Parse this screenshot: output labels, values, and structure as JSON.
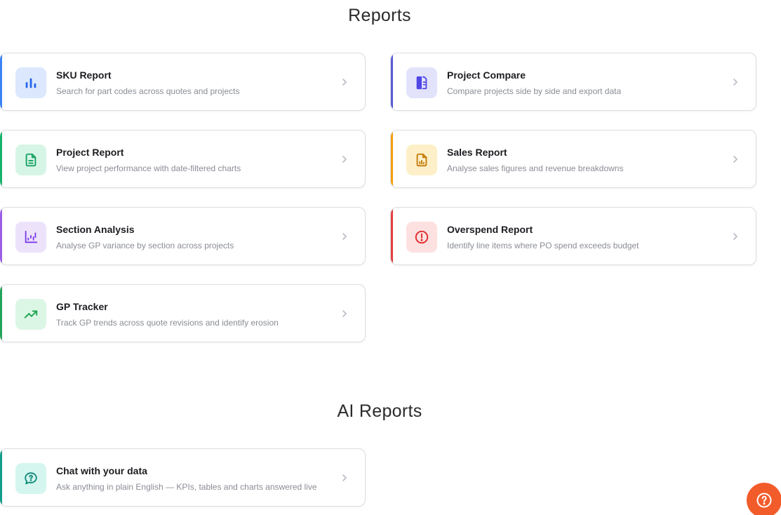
{
  "reports_heading": "Reports",
  "ai_reports_heading": "AI Reports",
  "cards": [
    {
      "title": "SKU Report",
      "description": "Search for part codes across quotes and projects",
      "accent": "#3b82f6",
      "icon_bg": "#dbe8fd",
      "icon_color": "#2563eb",
      "icon": "bar-chart-icon"
    },
    {
      "title": "Project Compare",
      "description": "Compare projects side by side and export data",
      "accent": "#5b5bd6",
      "icon_bg": "#e2e3fb",
      "icon_color": "#4f46e5",
      "icon": "compare-document-icon"
    },
    {
      "title": "Project Report",
      "description": "View project performance with date-filtered charts",
      "accent": "#16b36b",
      "icon_bg": "#d6f5e6",
      "icon_color": "#13a05f",
      "icon": "document-icon"
    },
    {
      "title": "Sales Report",
      "description": "Analyse sales figures and revenue breakdowns",
      "accent": "#f59e0b",
      "icon_bg": "#fdf0c8",
      "icon_color": "#c27803",
      "icon": "sales-document-icon"
    },
    {
      "title": "Section Analysis",
      "description": "Analyse GP variance by section across projects",
      "accent": "#9b5de5",
      "icon_bg": "#ece3fb",
      "icon_color": "#7c3aed",
      "icon": "waterfall-chart-icon"
    },
    {
      "title": "Overspend Report",
      "description": "Identify line items where PO spend exceeds budget",
      "accent": "#e53e3e",
      "icon_bg": "#fde0e0",
      "icon_color": "#dc2626",
      "icon": "alert-circle-icon"
    },
    {
      "title": "GP Tracker",
      "description": "Track GP trends across quote revisions and identify erosion",
      "accent": "#22a35a",
      "icon_bg": "#dcf6e5",
      "icon_color": "#16a34a",
      "icon": "trend-up-icon"
    },
    {
      "title": "Chat with your data",
      "description": "Ask anything in plain English — KPIs, tables and charts answered live",
      "accent": "#0f9d8a",
      "icon_bg": "#d4f6ef",
      "icon_color": "#0f8a78",
      "icon": "chat-question-icon"
    }
  ],
  "help_button_color": "#f25c2b"
}
